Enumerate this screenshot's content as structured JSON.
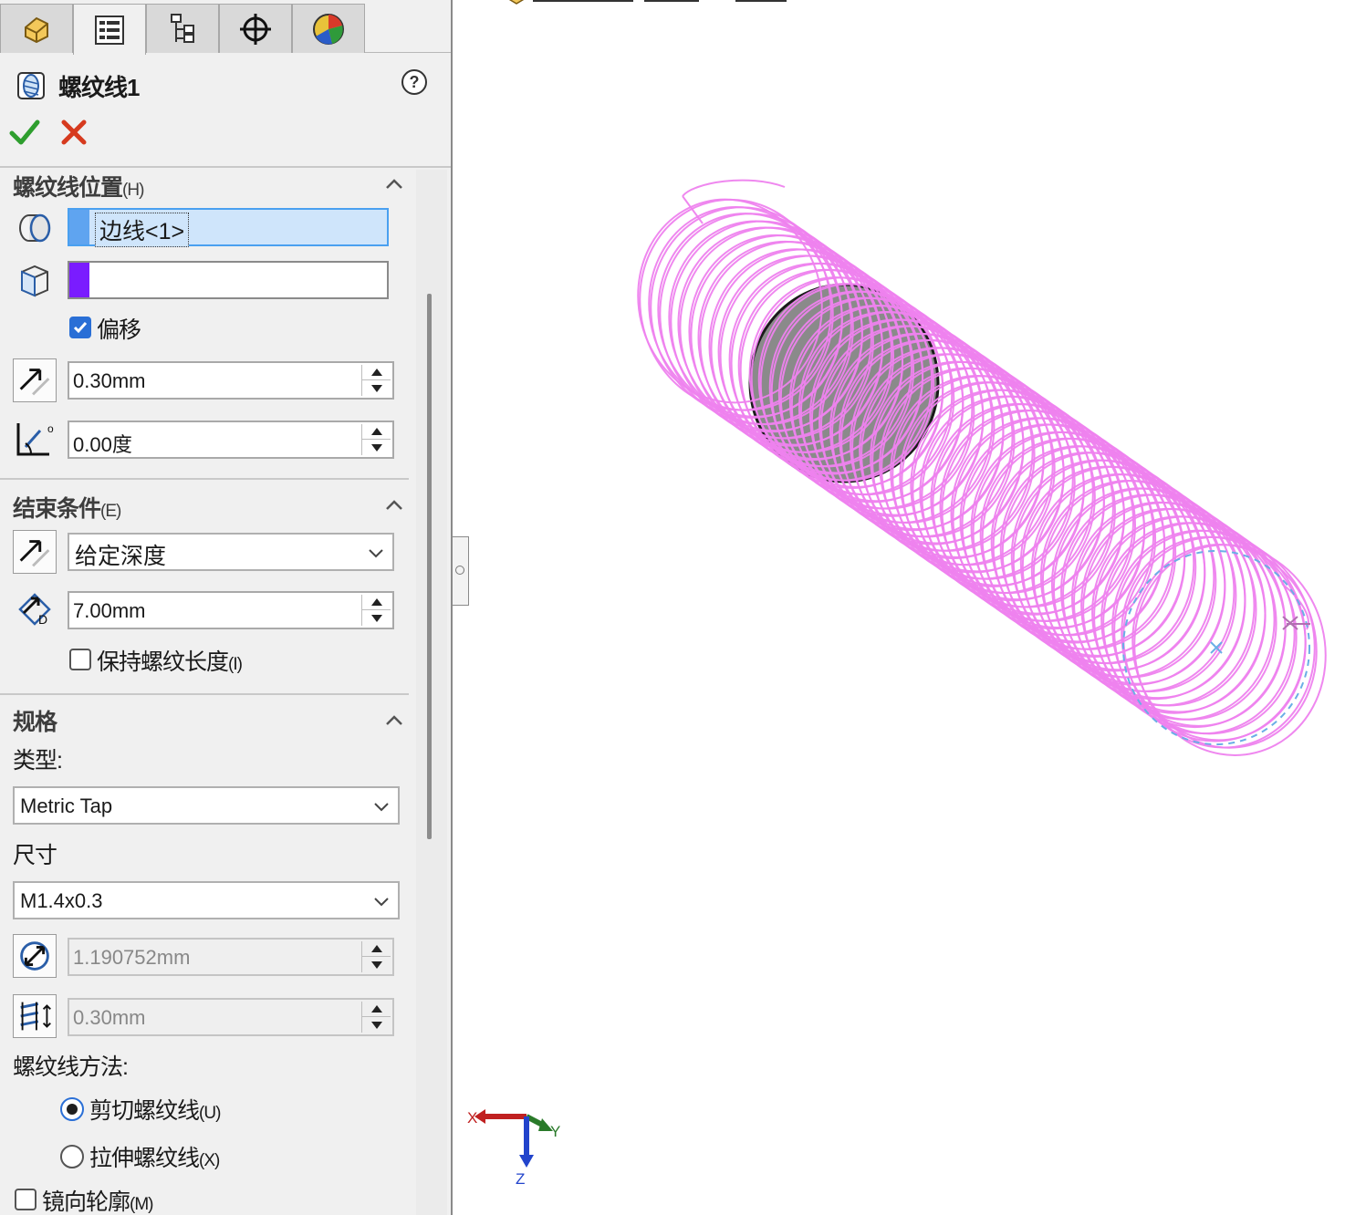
{
  "feature": {
    "title": "螺纹线1"
  },
  "tabs": [
    {
      "name": "feature-manager-tab",
      "icon": "feature-manager-icon"
    },
    {
      "name": "property-manager-tab",
      "icon": "property-manager-icon",
      "active": true
    },
    {
      "name": "configuration-manager-tab",
      "icon": "configuration-manager-icon"
    },
    {
      "name": "dimxpert-manager-tab",
      "icon": "crosshair-icon"
    },
    {
      "name": "display-manager-tab",
      "icon": "display-manager-icon"
    }
  ],
  "thread_location": {
    "title": "螺纹线位置",
    "shortcut": "(H)",
    "edge_value": "边线<1>",
    "face_value": "",
    "offset_label": "偏移",
    "offset_checked": true,
    "offset_distance": "0.30mm",
    "angle": "0.00度"
  },
  "end_condition": {
    "title": "结束条件",
    "shortcut": "(E)",
    "type": "给定深度",
    "depth": "7.00mm",
    "keep_length_label": "保持螺纹长度",
    "keep_length_shortcut": "(I)",
    "keep_length_checked": false
  },
  "specification": {
    "title": "规格",
    "type_label": "类型:",
    "type_value": "Metric Tap",
    "size_label": "尺寸",
    "size_value": "M1.4x0.3",
    "diameter": "1.190752mm",
    "pitch": "0.30mm",
    "method_label": "螺纹线方法:",
    "cut_label": "剪切螺纹线",
    "cut_shortcut": "(U)",
    "cut_selected": true,
    "extrude_label": "拉伸螺纹线",
    "extrude_shortcut": "(X)",
    "extrude_selected": false,
    "mirror_label": "镜向轮廓",
    "mirror_shortcut": "(M)",
    "mirror_checked": false
  },
  "triad": {
    "x": "X",
    "y": "Y",
    "z": "Z"
  },
  "colors": {
    "helix": "#ee82ee",
    "edge_swatch": "#5fa4f0",
    "face_swatch": "#7a1cff",
    "ok": "#2e9e2e",
    "cancel": "#d63a1e",
    "axis_x": "#c02020",
    "axis_y": "#2a7a2a",
    "axis_z": "#2244cc"
  }
}
